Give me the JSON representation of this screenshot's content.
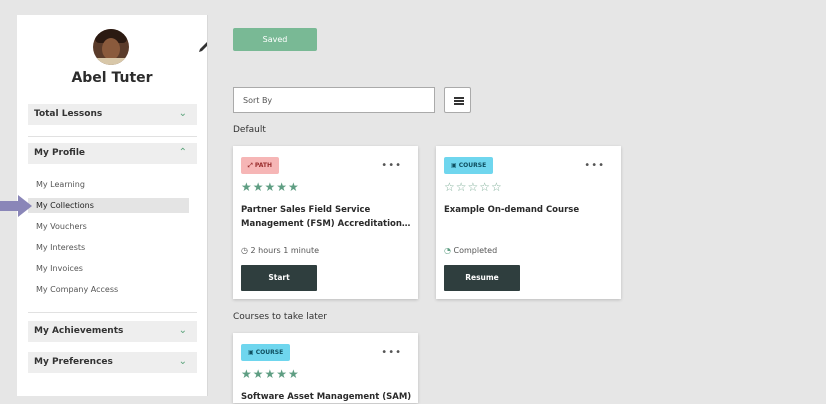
{
  "profile": {
    "name": "Abel Tuter"
  },
  "sidebar": {
    "sections": [
      {
        "label": "Total Lessons",
        "chevron": "⌄"
      },
      {
        "label": "My Profile",
        "chevron": "⌃"
      },
      {
        "label": "My Achievements",
        "chevron": "⌄"
      },
      {
        "label": "My Preferences",
        "chevron": "⌄"
      }
    ],
    "profile_items": [
      {
        "label": "My Learning",
        "active": false
      },
      {
        "label": "My Collections",
        "active": true
      },
      {
        "label": "My Vouchers",
        "active": false
      },
      {
        "label": "My Interests",
        "active": false
      },
      {
        "label": "My Invoices",
        "active": false
      },
      {
        "label": "My Company Access",
        "active": false
      }
    ]
  },
  "toolbar": {
    "saved_label": "Saved",
    "sort_placeholder": "Sort By"
  },
  "groups": [
    {
      "label": "Default"
    },
    {
      "label": "Courses to take later"
    }
  ],
  "cards": [
    {
      "type": "PATH",
      "title": "Partner Sales Field Service Management (FSM) Accreditation…",
      "rating": 5,
      "meta": "2 hours 1 minute",
      "button": "Start"
    },
    {
      "type": "COURSE",
      "title": "Example On-demand Course",
      "rating": 0,
      "meta": "Completed",
      "button": "Resume"
    },
    {
      "type": "COURSE",
      "title": "Software Asset Management (SAM)",
      "rating": 5
    }
  ],
  "icons": {
    "more": "more-options-icon",
    "edit": "pencil-icon",
    "list": "list-view-icon",
    "clock": "clock-icon",
    "progress": "progress-ring-icon"
  },
  "colors": {
    "accent": "#79b995",
    "star": "#5f9e83",
    "path_badge": "#f6b6b6",
    "course_badge": "#6fd6ee",
    "button_dark": "#2f3e3e"
  }
}
